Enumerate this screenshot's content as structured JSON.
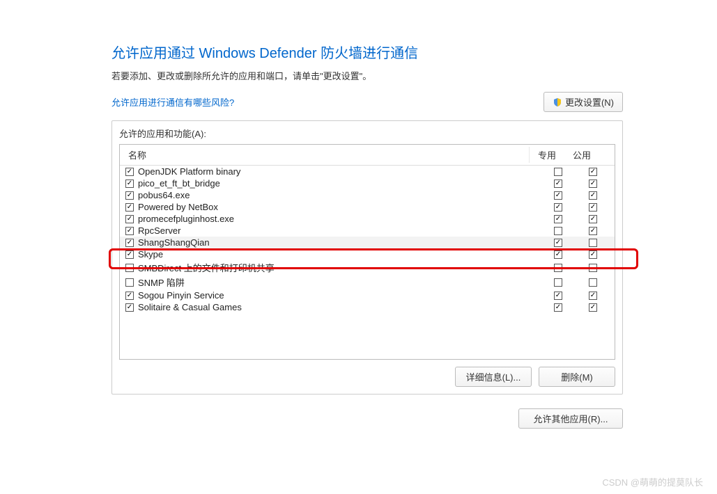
{
  "page": {
    "title": "允许应用通过 Windows Defender 防火墙进行通信",
    "subtitle": "若要添加、更改或删除所允许的应用和端口，请单击\"更改设置\"。",
    "risk_link": "允许应用进行通信有哪些风险?",
    "change_settings": "更改设置(N)"
  },
  "panel": {
    "label": "允许的应用和功能(A):",
    "col_name": "名称",
    "col_private": "专用",
    "col_public": "公用",
    "details_btn": "详细信息(L)...",
    "remove_btn": "删除(M)"
  },
  "apps": [
    {
      "enabled": true,
      "name": "OpenJDK Platform binary",
      "priv": false,
      "pub": true,
      "hl": false
    },
    {
      "enabled": true,
      "name": "pico_et_ft_bt_bridge",
      "priv": true,
      "pub": true,
      "hl": false
    },
    {
      "enabled": true,
      "name": "pobus64.exe",
      "priv": true,
      "pub": true,
      "hl": false
    },
    {
      "enabled": true,
      "name": "Powered by NetBox",
      "priv": true,
      "pub": true,
      "hl": false
    },
    {
      "enabled": true,
      "name": "promecefpluginhost.exe",
      "priv": true,
      "pub": true,
      "hl": false
    },
    {
      "enabled": true,
      "name": "RpcServer",
      "priv": false,
      "pub": true,
      "hl": false
    },
    {
      "enabled": true,
      "name": "ShangShangQian",
      "priv": true,
      "pub": false,
      "hl": true
    },
    {
      "enabled": true,
      "name": "Skype",
      "priv": true,
      "pub": true,
      "hl": false
    },
    {
      "enabled": false,
      "name": "SMBDirect 上的文件和打印机共享",
      "priv": false,
      "pub": false,
      "hl": false
    },
    {
      "enabled": false,
      "name": "SNMP 陷阱",
      "priv": false,
      "pub": false,
      "hl": false
    },
    {
      "enabled": true,
      "name": "Sogou Pinyin Service",
      "priv": true,
      "pub": true,
      "hl": false
    },
    {
      "enabled": true,
      "name": "Solitaire & Casual Games",
      "priv": true,
      "pub": true,
      "hl": false
    }
  ],
  "allow_other": "允许其他应用(R)...",
  "watermark": "CSDN @萌萌的提莫队长"
}
